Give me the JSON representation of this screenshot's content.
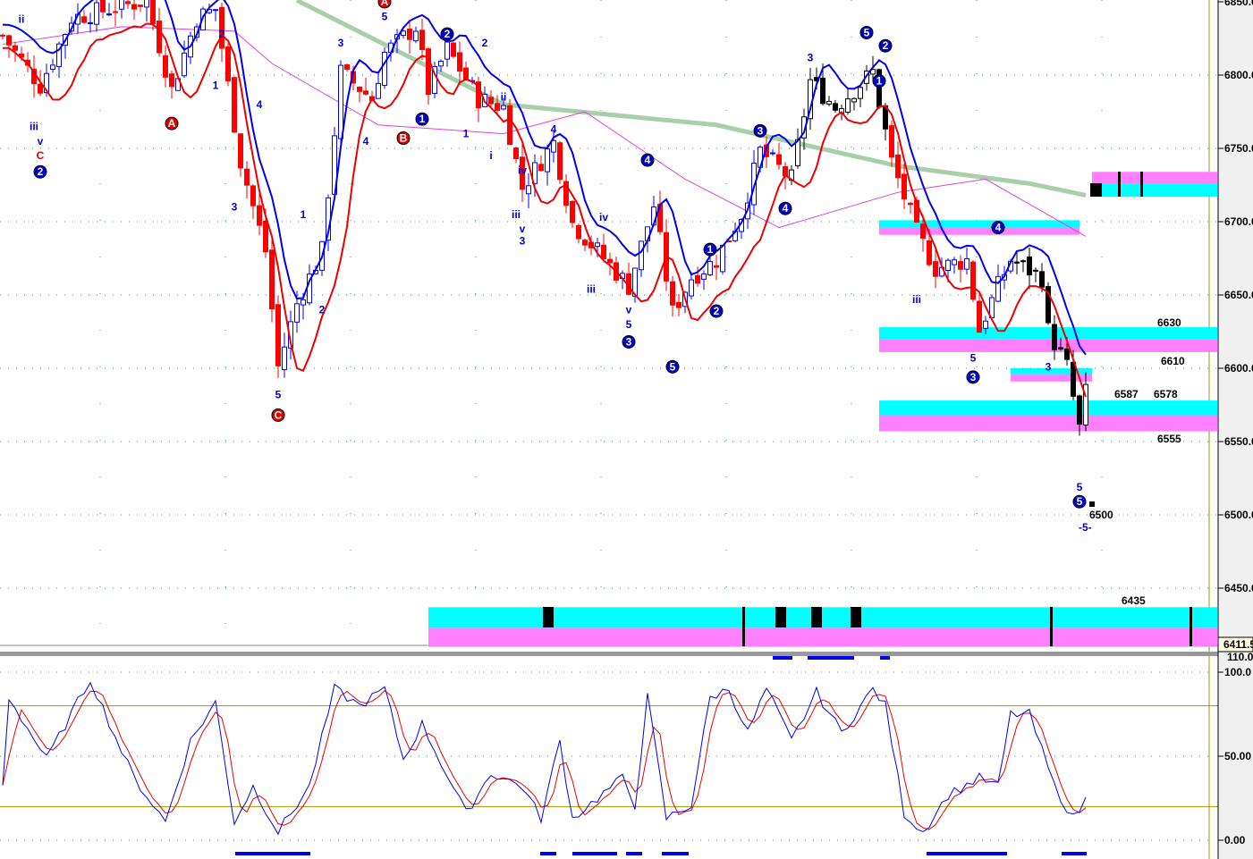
{
  "chart_data": {
    "type": "candlestick",
    "price_axis": {
      "ticks": [
        "6850.0",
        "6800.0",
        "6750.0",
        "6700.0",
        "6650.0",
        "6600.0",
        "6550.0",
        "6500.0",
        "6450.0"
      ],
      "tick_values": [
        6850,
        6800,
        6750,
        6700,
        6650,
        6600,
        6550,
        6500,
        6450
      ],
      "ylim": [
        6408,
        6851
      ],
      "last_price": "6411.5"
    },
    "osc_axis": {
      "ticks": [
        "100.0",
        "50.00",
        "0.00"
      ],
      "tick_values": [
        100,
        50,
        0
      ],
      "top_label": "110.0",
      "ylim": [
        0,
        110
      ],
      "levels": [
        80,
        20
      ]
    },
    "close_path": [
      [
        0,
        6827
      ],
      [
        6,
        6793
      ],
      [
        11,
        6839
      ],
      [
        23,
        6851
      ],
      [
        27,
        6790
      ],
      [
        31,
        6839
      ],
      [
        34,
        6845
      ],
      [
        38,
        6741
      ],
      [
        42,
        6680
      ],
      [
        44,
        6601
      ],
      [
        47,
        6644
      ],
      [
        51,
        6680
      ],
      [
        54,
        6802
      ],
      [
        59,
        6784
      ],
      [
        61,
        6815
      ],
      [
        66,
        6833
      ],
      [
        68,
        6790
      ],
      [
        71,
        6818
      ],
      [
        76,
        6784
      ],
      [
        80,
        6778
      ],
      [
        83,
        6723
      ],
      [
        88,
        6754
      ],
      [
        91,
        6699
      ],
      [
        95,
        6680
      ],
      [
        100,
        6656
      ],
      [
        104,
        6711
      ],
      [
        107,
        6638
      ],
      [
        110,
        6662
      ],
      [
        114,
        6674
      ],
      [
        118,
        6705
      ],
      [
        121,
        6748
      ],
      [
        126,
        6729
      ],
      [
        129,
        6796
      ],
      [
        133,
        6778
      ],
      [
        139,
        6802
      ],
      [
        142,
        6741
      ],
      [
        146,
        6693
      ],
      [
        149,
        6668
      ],
      [
        154,
        6674
      ],
      [
        156,
        6626
      ],
      [
        159,
        6656
      ],
      [
        161,
        6674
      ],
      [
        166,
        6662
      ],
      [
        167,
        6626
      ],
      [
        170,
        6601
      ],
      [
        172,
        6559
      ],
      [
        173,
        6583
      ]
    ],
    "green_ma": [
      [
        47,
        6851
      ],
      [
        80,
        6780
      ],
      [
        114,
        6766
      ],
      [
        143,
        6738
      ],
      [
        164,
        6726
      ],
      [
        173,
        6718
      ]
    ],
    "magenta_ma": [
      [
        0,
        6821
      ],
      [
        19,
        6833
      ],
      [
        37,
        6830
      ],
      [
        43,
        6808
      ],
      [
        60,
        6766
      ],
      [
        80,
        6760
      ],
      [
        93,
        6775
      ],
      [
        109,
        6729
      ],
      [
        124,
        6696
      ],
      [
        143,
        6720
      ],
      [
        157,
        6729
      ],
      [
        173,
        6690
      ]
    ],
    "zones": [
      {
        "from": 174,
        "to": 194,
        "cyan": [
          6726,
          6717
        ],
        "magenta": [
          6734,
          6726
        ],
        "label": ""
      },
      {
        "from": 140,
        "to": 172,
        "cyan": [
          6701,
          6696
        ],
        "magenta": [
          6696,
          6691
        ],
        "label": ""
      },
      {
        "from": 140,
        "to": 194,
        "cyan": [
          6628,
          6620
        ],
        "magenta": [
          6620,
          6611
        ],
        "label": "6630",
        "label2": "6610"
      },
      {
        "from": 161,
        "to": 174,
        "cyan": [
          6600,
          6596
        ],
        "magenta": [
          6596,
          6591
        ],
        "label": ""
      },
      {
        "from": 140,
        "to": 194,
        "cyan": [
          6578,
          6568
        ],
        "magenta": [
          6568,
          6557
        ],
        "label": "6578",
        "label2": "6555",
        "label3": "6587"
      },
      {
        "from": 68,
        "to": 194,
        "cyan": [
          6437,
          6423
        ],
        "magenta": [
          6423,
          6410
        ],
        "label": "6435"
      }
    ],
    "target_label": "6500",
    "target_sublabel": "-5-",
    "wave_labels": [
      {
        "t": "ii",
        "i": 3,
        "p": 6838,
        "c": "#0000cc",
        "circle": false
      },
      {
        "t": "iii",
        "i": 5,
        "p": 6765,
        "c": "#0000cc",
        "circle": false
      },
      {
        "t": "v",
        "i": 6,
        "p": 6755,
        "c": "#0000cc",
        "circle": false
      },
      {
        "t": "C",
        "i": 6,
        "p": 6745,
        "c": "#e00000",
        "circle": false
      },
      {
        "t": "2",
        "i": 6,
        "p": 6734,
        "c": "#0000cc",
        "circle": true
      },
      {
        "t": "A",
        "i": 27,
        "p": 6767,
        "c": "#e00000",
        "circle": true
      },
      {
        "t": "1",
        "i": 34,
        "p": 6793,
        "c": "#0000cc",
        "circle": false
      },
      {
        "t": "2",
        "i": 35,
        "p": 6828,
        "c": "#0000cc",
        "circle": false
      },
      {
        "t": "3",
        "i": 37,
        "p": 6710,
        "c": "#0000cc",
        "circle": false
      },
      {
        "t": "4",
        "i": 41,
        "p": 6780,
        "c": "#0000cc",
        "circle": false
      },
      {
        "t": "5",
        "i": 44,
        "p": 6582,
        "c": "#0000cc",
        "circle": false
      },
      {
        "t": "C",
        "i": 44,
        "p": 6568,
        "c": "#e00000",
        "circle": true
      },
      {
        "t": "1",
        "i": 48,
        "p": 6705,
        "c": "#0000cc",
        "circle": false
      },
      {
        "t": "2",
        "i": 51,
        "p": 6640,
        "c": "#0000cc",
        "circle": false
      },
      {
        "t": "3",
        "i": 54,
        "p": 6822,
        "c": "#0000cc",
        "circle": false
      },
      {
        "t": "4",
        "i": 58,
        "p": 6755,
        "c": "#0000cc",
        "circle": false
      },
      {
        "t": "5",
        "i": 61,
        "p": 6840,
        "c": "#0000cc",
        "circle": false
      },
      {
        "t": "A",
        "i": 61,
        "p": 6850,
        "c": "#e00000",
        "circle": true
      },
      {
        "t": "B",
        "i": 64,
        "p": 6757,
        "c": "#e00000",
        "circle": true
      },
      {
        "t": "1",
        "i": 67,
        "p": 6770,
        "c": "#0000cc",
        "circle": true
      },
      {
        "t": "2",
        "i": 71,
        "p": 6828,
        "c": "#0000cc",
        "circle": true
      },
      {
        "t": "2",
        "i": 77,
        "p": 6822,
        "c": "#0000cc",
        "circle": false
      },
      {
        "t": "1",
        "i": 74,
        "p": 6760,
        "c": "#0000cc",
        "circle": false
      },
      {
        "t": "ii",
        "i": 80,
        "p": 6785,
        "c": "#0000cc",
        "circle": false
      },
      {
        "t": "i",
        "i": 78,
        "p": 6745,
        "c": "#0000cc",
        "circle": false
      },
      {
        "t": "iv",
        "i": 83,
        "p": 6735,
        "c": "#0000cc",
        "circle": false
      },
      {
        "t": "iii",
        "i": 82,
        "p": 6705,
        "c": "#0000cc",
        "circle": false
      },
      {
        "t": "v",
        "i": 83,
        "p": 6695,
        "c": "#0000cc",
        "circle": false
      },
      {
        "t": "3",
        "i": 83,
        "p": 6687,
        "c": "#0000cc",
        "circle": false
      },
      {
        "t": "4",
        "i": 88,
        "p": 6763,
        "c": "#0000cc",
        "circle": false
      },
      {
        "t": "iii",
        "i": 94,
        "p": 6654,
        "c": "#0000cc",
        "circle": false
      },
      {
        "t": "iv",
        "i": 96,
        "p": 6703,
        "c": "#0000cc",
        "circle": false
      },
      {
        "t": "4",
        "i": 103,
        "p": 6742,
        "c": "#0000cc",
        "circle": true
      },
      {
        "t": "v",
        "i": 100,
        "p": 6640,
        "c": "#0000cc",
        "circle": false
      },
      {
        "t": "5",
        "i": 100,
        "p": 6630,
        "c": "#0000cc",
        "circle": false
      },
      {
        "t": "3",
        "i": 100,
        "p": 6618,
        "c": "#0000cc",
        "circle": true
      },
      {
        "t": "5",
        "i": 107,
        "p": 6601,
        "c": "#0000cc",
        "circle": true
      },
      {
        "t": "1",
        "i": 113,
        "p": 6681,
        "c": "#0000cc",
        "circle": true
      },
      {
        "t": "2",
        "i": 114,
        "p": 6639,
        "c": "#0000cc",
        "circle": true
      },
      {
        "t": "3",
        "i": 121,
        "p": 6762,
        "c": "#0000cc",
        "circle": true
      },
      {
        "t": "4",
        "i": 125,
        "p": 6709,
        "c": "#0000cc",
        "circle": true
      },
      {
        "t": "3",
        "i": 129,
        "p": 6812,
        "c": "#0000cc",
        "circle": false
      },
      {
        "t": "5",
        "i": 138,
        "p": 6829,
        "c": "#0000cc",
        "circle": true
      },
      {
        "t": "2",
        "i": 141,
        "p": 6820,
        "c": "#0000cc",
        "circle": true
      },
      {
        "t": "1",
        "i": 140,
        "p": 6796,
        "c": "#0000cc",
        "circle": true
      },
      {
        "t": "iii",
        "i": 146,
        "p": 6647,
        "c": "#0000cc",
        "circle": false
      },
      {
        "t": "4",
        "i": 159,
        "p": 6696,
        "c": "#0000cc",
        "circle": true
      },
      {
        "t": "5",
        "i": 155,
        "p": 6607,
        "c": "#0000cc",
        "circle": false
      },
      {
        "t": "3",
        "i": 155,
        "p": 6594,
        "c": "#0000cc",
        "circle": true
      },
      {
        "t": "3",
        "i": 167,
        "p": 6601,
        "c": "#0000cc",
        "circle": false
      },
      {
        "t": "5",
        "i": 172,
        "p": 6519,
        "c": "#0000cc",
        "circle": false
      },
      {
        "t": "5",
        "i": 172,
        "p": 6509,
        "c": "#0000cc",
        "circle": true
      }
    ],
    "osc_k": [
      [
        0,
        32
      ],
      [
        1,
        85
      ],
      [
        7,
        48
      ],
      [
        14,
        96
      ],
      [
        19,
        53
      ],
      [
        21,
        37
      ],
      [
        26,
        11
      ],
      [
        30,
        59
      ],
      [
        34,
        82
      ],
      [
        37,
        11
      ],
      [
        40,
        32
      ],
      [
        44,
        5
      ],
      [
        49,
        32
      ],
      [
        53,
        90
      ],
      [
        57,
        80
      ],
      [
        61,
        90
      ],
      [
        64,
        48
      ],
      [
        67,
        69
      ],
      [
        74,
        16
      ],
      [
        78,
        40
      ],
      [
        83,
        32
      ],
      [
        86,
        13
      ],
      [
        89,
        59
      ],
      [
        91,
        13
      ],
      [
        99,
        37
      ],
      [
        101,
        21
      ],
      [
        103,
        85
      ],
      [
        106,
        13
      ],
      [
        110,
        21
      ],
      [
        113,
        85
      ],
      [
        116,
        90
      ],
      [
        119,
        64
      ],
      [
        122,
        90
      ],
      [
        126,
        59
      ],
      [
        130,
        88
      ],
      [
        134,
        64
      ],
      [
        139,
        90
      ],
      [
        141,
        80
      ],
      [
        144,
        16
      ],
      [
        147,
        5
      ],
      [
        151,
        27
      ],
      [
        156,
        37
      ],
      [
        159,
        32
      ],
      [
        161,
        75
      ],
      [
        164,
        75
      ],
      [
        168,
        32
      ],
      [
        171,
        13
      ],
      [
        173,
        24
      ]
    ]
  }
}
